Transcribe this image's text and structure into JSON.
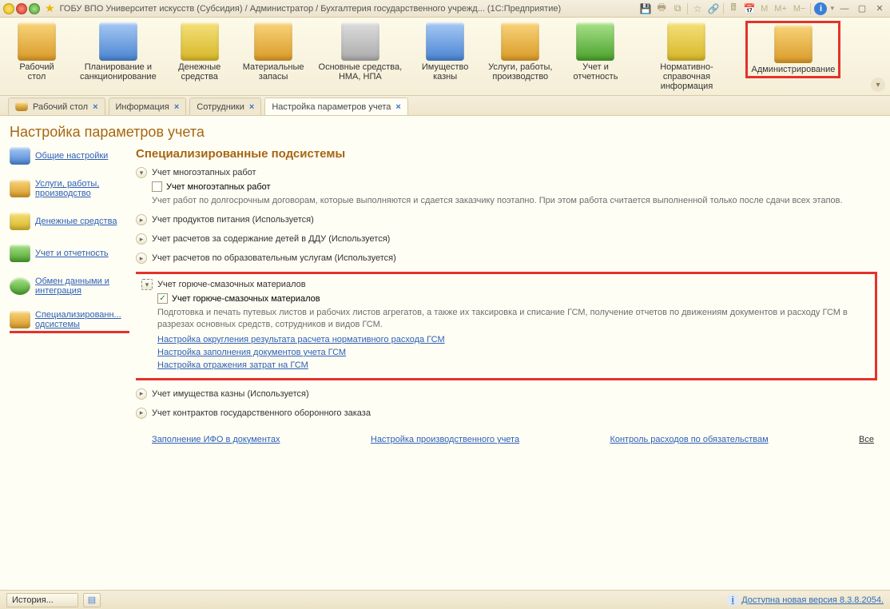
{
  "title": "ГОБУ ВПО Университет искусств (Субсидия) / Администратор / Бухгалтерия государственного учрежд...  (1С:Предприятие)",
  "titlebar_tools": {
    "m": "M",
    "m_plus": "M+",
    "m_minus": "M−"
  },
  "sections": [
    {
      "id": "desktop",
      "label": "Рабочий\nстол"
    },
    {
      "id": "planning",
      "label": "Планирование и\nсанкционирование"
    },
    {
      "id": "cash",
      "label": "Денежные\nсредства"
    },
    {
      "id": "materials",
      "label": "Материальные\nзапасы"
    },
    {
      "id": "assets",
      "label": "Основные средства,\nНМА, НПА"
    },
    {
      "id": "treasury",
      "label": "Имущество\nказны"
    },
    {
      "id": "services",
      "label": "Услуги, работы,\nпроизводство"
    },
    {
      "id": "reporting",
      "label": "Учет и\nотчетность"
    },
    {
      "id": "normative",
      "label": "Нормативно-справочная\nинформация"
    },
    {
      "id": "admin",
      "label": "Администрирование"
    }
  ],
  "tabs": [
    {
      "label": "Рабочий стол",
      "icon": true
    },
    {
      "label": "Информация"
    },
    {
      "label": "Сотрудники"
    },
    {
      "label": "Настройка параметров учета",
      "active": true
    }
  ],
  "page_title": "Настройка параметров учета",
  "side_nav": [
    {
      "label": "Общие настройки"
    },
    {
      "label": "Услуги, работы, производство"
    },
    {
      "label": "Денежные средства"
    },
    {
      "label": "Учет и отчетность"
    },
    {
      "label": "Обмен данными и интеграция"
    },
    {
      "label": "Специализированн... одсистемы",
      "active": true
    }
  ],
  "content": {
    "heading": "Специализированные подсистемы",
    "block1": {
      "title": "Учет многоэтапных работ",
      "chk_label": "Учет многоэтапных работ",
      "chk_checked": false,
      "desc": "Учет работ по долгосрочным договорам, которые выполняются и сдается заказчику поэтапно. При этом работа считается выполненной только после сдачи всех этапов."
    },
    "block2": {
      "title": "Учет продуктов питания (Используется)"
    },
    "block3": {
      "title": "Учет расчетов за содержание детей в ДДУ (Используется)"
    },
    "block4": {
      "title": "Учет расчетов по образовательным услугам (Используется)"
    },
    "block5": {
      "title": "Учет горюче-смазочных материалов",
      "chk_label": "Учет горюче-смазочных материалов",
      "chk_checked": true,
      "desc": "Подготовка и печать путевых листов и рабочих листов агрегатов, а также их таксировка и списание ГСМ, получение отчетов по движениям документов и расходу ГСМ в разрезах основных средств, сотрудников и видов ГСМ.",
      "links": [
        "Настройка округления результата расчета нормативного расхода ГСМ",
        "Настройка заполнения документов учета ГСМ",
        "Настройка отражения затрат на ГСМ"
      ]
    },
    "block6": {
      "title": "Учет имущества казны (Используется)"
    },
    "block7": {
      "title": "Учет контрактов государственного оборонного заказа"
    },
    "footer_links": {
      "l1": "Заполнение ИФО в документах",
      "l2": "Настройка производственного учета",
      "l3": "Контроль расходов по обязательствам",
      "all": "Все"
    }
  },
  "statusbar": {
    "history": "История...",
    "update": "Доступна новая версия 8.3.8.2054."
  }
}
